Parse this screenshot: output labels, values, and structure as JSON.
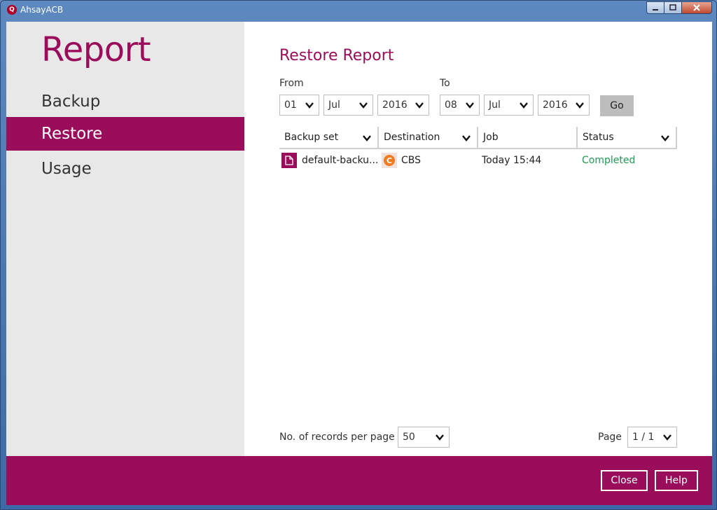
{
  "window": {
    "title": "AhsayACB",
    "app_icon_letter": "Q"
  },
  "sidebar": {
    "heading": "Report",
    "items": [
      {
        "label": "Backup",
        "active": false
      },
      {
        "label": "Restore",
        "active": true
      },
      {
        "label": "Usage",
        "active": false
      }
    ]
  },
  "main": {
    "title": "Restore Report",
    "from_label": "From",
    "to_label": "To",
    "from": {
      "day": "01",
      "month": "Jul",
      "year": "2016"
    },
    "to": {
      "day": "08",
      "month": "Jul",
      "year": "2016"
    },
    "go_label": "Go",
    "table": {
      "columns": [
        "Backup set",
        "Destination",
        "Job",
        "Status"
      ],
      "rows": [
        {
          "backup_set": "default-backu...",
          "destination": "CBS",
          "job": "Today 15:44",
          "status": "Completed"
        }
      ]
    },
    "records_label": "No. of records per page",
    "records_value": "50",
    "page_label": "Page",
    "page_value": "1 / 1"
  },
  "footer": {
    "close_label": "Close",
    "help_label": "Help"
  },
  "colors": {
    "accent": "#9a0d5a",
    "status_completed": "#1e9b54",
    "cbs_icon": "#f07a22"
  },
  "icons": [
    "file-icon",
    "cbs-icon",
    "chevron-down-icon"
  ]
}
